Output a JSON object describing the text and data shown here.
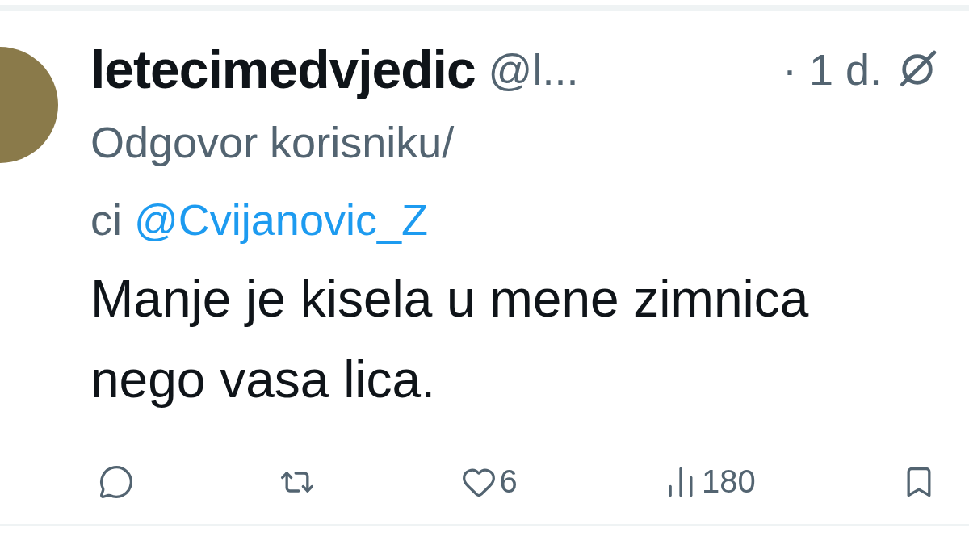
{
  "tweet": {
    "author": {
      "name": "letecimedvjedic",
      "handle": "@l...",
      "time": "· 1 d."
    },
    "reply_to": {
      "prefix": "Odgovor korisniku/",
      "pre_mention": "ci",
      "mention": "@Cvijanovic_Z"
    },
    "text": "Manje je kisela u mene zimnica nego vasa lica.",
    "actions": [
      {
        "kind": "reply"
      },
      {
        "kind": "repost"
      },
      {
        "kind": "like",
        "count": "6"
      },
      {
        "kind": "views",
        "count": "180"
      },
      {
        "kind": "bookmark"
      }
    ]
  }
}
